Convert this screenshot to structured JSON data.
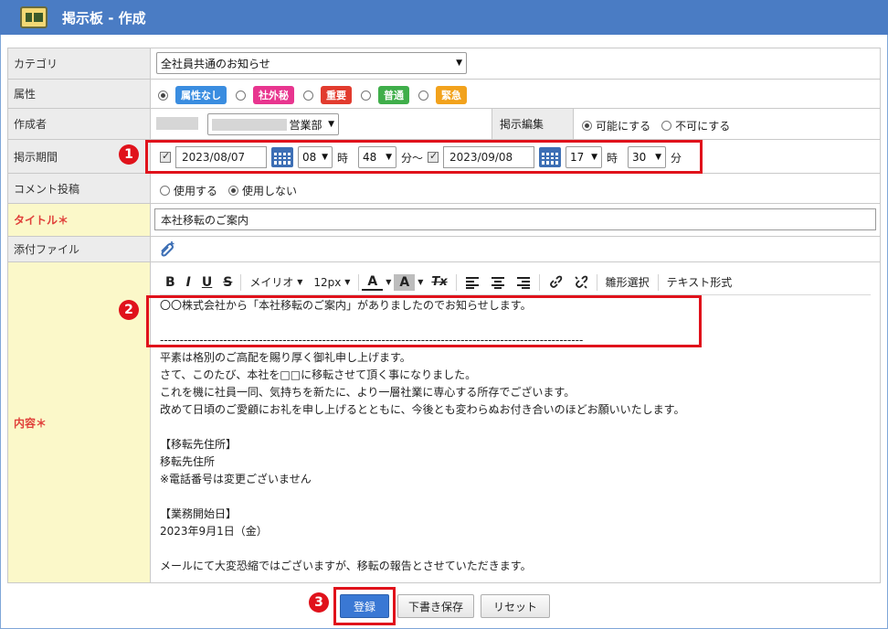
{
  "titlebar": {
    "title": "掲示板 - 作成"
  },
  "labels": {
    "category": "カテゴリ",
    "attribute": "属性",
    "author": "作成者",
    "period": "掲示期間",
    "comment": "コメント投稿",
    "title": "タイトル＊",
    "attachment": "添付ファイル",
    "content": "内容＊"
  },
  "category": {
    "selected": "全社員共通のお知らせ"
  },
  "attributes": [
    {
      "label": "属性なし",
      "color": "#3a8de0",
      "selected": true
    },
    {
      "label": "社外秘",
      "color": "#e8358f",
      "selected": false
    },
    {
      "label": "重要",
      "color": "#e23b2e",
      "selected": false
    },
    {
      "label": "普通",
      "color": "#3fae4a",
      "selected": false
    },
    {
      "label": "緊急",
      "color": "#f2a21c",
      "selected": false
    }
  ],
  "author": {
    "dept": "営業部",
    "edit_label": "掲示編集",
    "allow": "可能にする",
    "deny": "不可にする"
  },
  "period": {
    "start_date": "2023/08/07",
    "start_hour": "08",
    "start_min": "48",
    "hour_unit": "時",
    "min_unit_tilde": "分〜",
    "end_date": "2023/09/08",
    "end_hour": "17",
    "end_min": "30",
    "min_unit": "分"
  },
  "comment": {
    "use": "使用する",
    "nouse": "使用しない"
  },
  "title_value": "本社移転のご案内",
  "toolbar": {
    "bold": "B",
    "italic": "I",
    "underline": "U",
    "strike": "S",
    "font": "メイリオ",
    "size": "12px",
    "font_color": "A",
    "bg_color": "A",
    "clear": "Tx",
    "templates": "雛形選択",
    "text_mode": "テキスト形式"
  },
  "content_lines": [
    "〇〇株式会社から「本社移転のご案内」がありましたのでお知らせします。",
    "",
    "-----------------------------------------------------------------------------------------------------------",
    "平素は格別のご高配を賜り厚く御礼申し上げます。",
    "さて、このたび、本社を□□に移転させて頂く事になりました。",
    "これを機に社員一同、気持ちを新たに、より一層社業に専心する所存でございます。",
    "改めて日頃のご愛顧にお礼を申し上げるとともに、今後とも変わらぬお付き合いのほどお願いいたします。",
    "",
    "【移転先住所】",
    "移転先住所",
    "※電話番号は変更ございません",
    "",
    "【業務開始日】",
    "2023年9月1日（金）",
    "",
    "メールにて大変恐縮ではございますが、移転の報告とさせていただきます。"
  ],
  "buttons": {
    "register": "登録",
    "draft": "下書き保存",
    "reset": "リセット"
  },
  "annotations": {
    "n1": "1",
    "n2": "2",
    "n3": "3"
  }
}
